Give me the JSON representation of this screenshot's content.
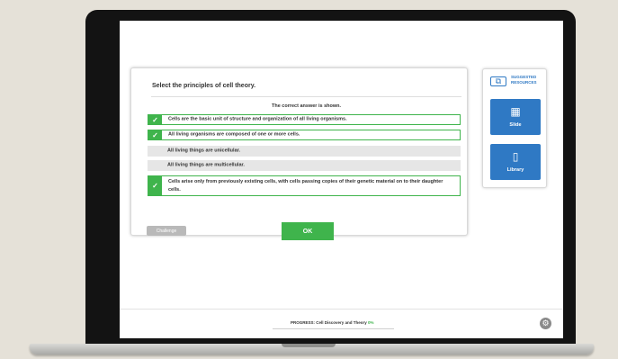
{
  "question": {
    "prompt": "Select the principles of cell theory.",
    "answer_note": "The correct answer is shown.",
    "options": [
      {
        "text": "Cells are the basic unit of structure and organization of all living organisms.",
        "correct": true
      },
      {
        "text": "All living organisms are composed of one or more cells.",
        "correct": true
      },
      {
        "text": "All living things are unicellular.",
        "correct": false
      },
      {
        "text": "All living things are multicellular.",
        "correct": false
      },
      {
        "text": "Cells arise only from previously existing cells, with cells passing copies of their genetic material on to their daughter cells.",
        "correct": true
      }
    ],
    "challenge_label": "Challenge",
    "ok_label": "OK"
  },
  "resources": {
    "title": "SUGGESTED RESOURCES",
    "items": [
      {
        "label": "Slide",
        "icon": "slide-icon"
      },
      {
        "label": "Library",
        "icon": "library-icon"
      }
    ]
  },
  "footer": {
    "progress_label": "PROGRESS: Cell Discovery and Theory",
    "progress_value": "0%",
    "progress_fraction": 0.0,
    "settings_icon": "settings-icon"
  },
  "colors": {
    "correct_green": "#3fb44c",
    "resource_blue": "#2f79c4",
    "challenge_gray": "#b9b9b9"
  }
}
